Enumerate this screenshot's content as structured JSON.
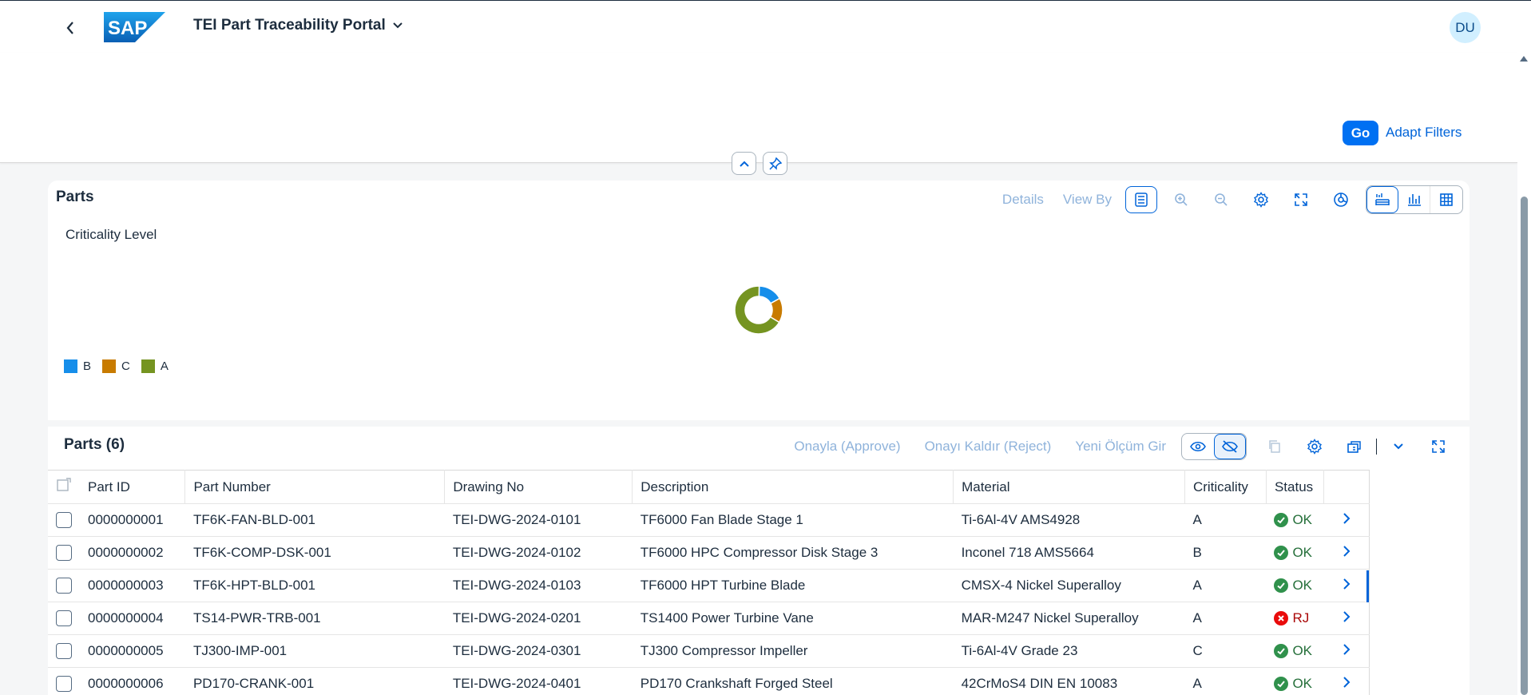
{
  "shell": {
    "title": "TEI Part Traceability Portal",
    "avatar_initials": "DU",
    "logo_text": "SAP"
  },
  "filterbar": {
    "go_label": "Go",
    "adapt_label": "Adapt Filters"
  },
  "chart_card": {
    "title": "Parts",
    "toolbar": {
      "details_label": "Details",
      "viewby_label": "View By"
    },
    "subtitle": "Criticality Level"
  },
  "chart_data": {
    "type": "pie",
    "title": "Criticality Level",
    "categories": [
      "B",
      "C",
      "A"
    ],
    "values": [
      1,
      1,
      4
    ],
    "colors": [
      "#168eea",
      "#c87b00",
      "#759421"
    ],
    "donut": true,
    "legend": "bottom-left"
  },
  "table_card": {
    "title": "Parts (6)",
    "toolbar": {
      "approve_label": "Onayla (Approve)",
      "reject_label": "Onayı Kaldır (Reject)",
      "new_measure_label": "Yeni Ölçüm Gir"
    },
    "columns": [
      "Part ID",
      "Part Number",
      "Drawing No",
      "Description",
      "Material",
      "Criticality",
      "Status"
    ],
    "rows": [
      {
        "id": "0000000001",
        "pn": "TF6K-FAN-BLD-001",
        "dwg": "TEI-DWG-2024-0101",
        "desc": "TF6000 Fan Blade Stage 1",
        "mat": "Ti-6Al-4V AMS4928",
        "crit": "A",
        "status": "OK"
      },
      {
        "id": "0000000002",
        "pn": "TF6K-COMP-DSK-001",
        "dwg": "TEI-DWG-2024-0102",
        "desc": "TF6000 HPC Compressor Disk Stage 3",
        "mat": "Inconel 718 AMS5664",
        "crit": "B",
        "status": "OK"
      },
      {
        "id": "0000000003",
        "pn": "TF6K-HPT-BLD-001",
        "dwg": "TEI-DWG-2024-0103",
        "desc": "TF6000 HPT Turbine Blade",
        "mat": "CMSX-4 Nickel Superalloy",
        "crit": "A",
        "status": "OK"
      },
      {
        "id": "0000000004",
        "pn": "TS14-PWR-TRB-001",
        "dwg": "TEI-DWG-2024-0201",
        "desc": "TS1400 Power Turbine Vane",
        "mat": "MAR-M247 Nickel Superalloy",
        "crit": "A",
        "status": "RJ"
      },
      {
        "id": "0000000005",
        "pn": "TJ300-IMP-001",
        "dwg": "TEI-DWG-2024-0301",
        "desc": "TJ300 Compressor Impeller",
        "mat": "Ti-6Al-4V Grade 23",
        "crit": "C",
        "status": "OK"
      },
      {
        "id": "0000000006",
        "pn": "PD170-CRANK-001",
        "dwg": "TEI-DWG-2024-0401",
        "desc": "PD170 Crankshaft Forged Steel",
        "mat": "42CrMoS4 DIN EN 10083",
        "crit": "A",
        "status": "OK"
      }
    ]
  }
}
